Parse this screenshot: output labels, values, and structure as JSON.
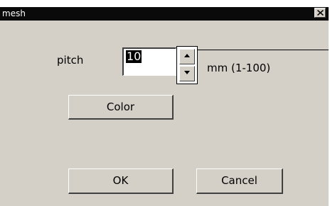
{
  "window": {
    "title": "mesh",
    "close_icon": "close-icon"
  },
  "form": {
    "pitch_label": "pitch",
    "pitch_value": "10",
    "unit_label": "mm (1-100)",
    "spin_up_icon": "up-arrow-icon",
    "spin_down_icon": "down-arrow-icon"
  },
  "buttons": {
    "color_label": "Color",
    "ok_label": "OK",
    "cancel_label": "Cancel"
  },
  "colors": {
    "face": "#d4d0c8",
    "titlebar": "#0a0a0a",
    "selection": "#000000"
  }
}
